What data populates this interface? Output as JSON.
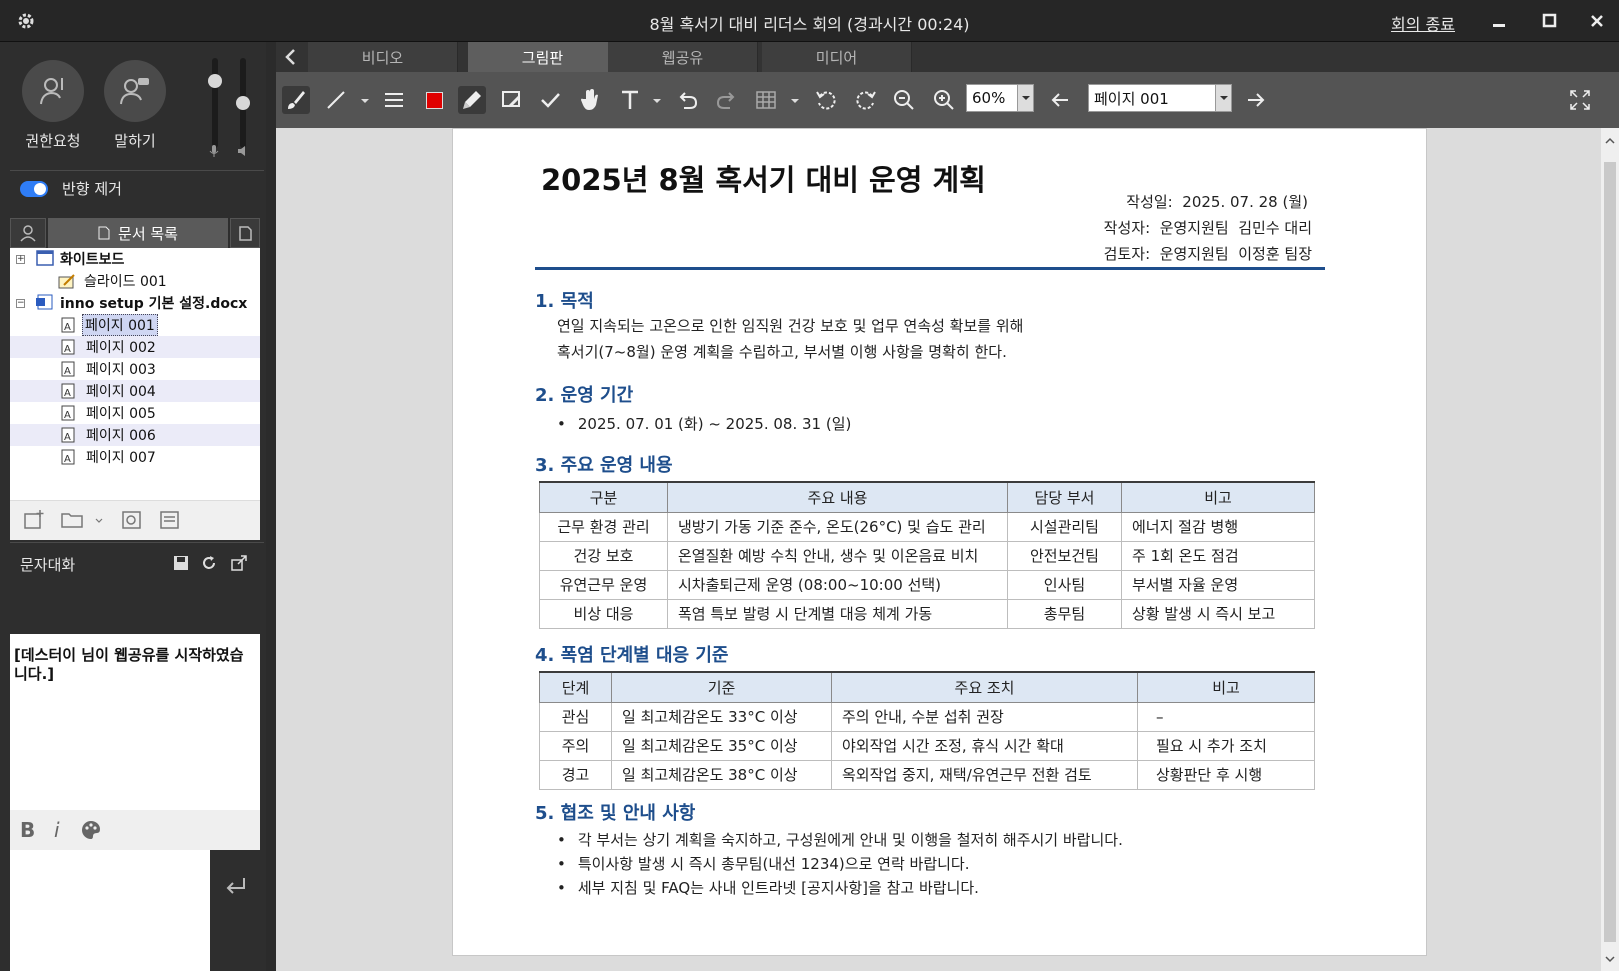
{
  "window": {
    "title": "8월 혹서기 대비 리더스 회의 (경과시간 00:24)",
    "end_meeting": "회의 종료"
  },
  "left": {
    "request_label": "권한요청",
    "speak_label": "말하기",
    "echo_label": "반향 제거",
    "echo_on": true,
    "doc_tab_label": "문서 목록",
    "tree": [
      {
        "label": "화이트보드",
        "level": 0,
        "type": "whiteboard"
      },
      {
        "label": "슬라이드 001",
        "level": 1,
        "type": "slide"
      },
      {
        "label": "inno setup 기본 설정.docx",
        "level": 0,
        "type": "docx"
      },
      {
        "label": "페이지 001",
        "level": 1,
        "type": "page",
        "selected": true
      },
      {
        "label": "페이지 002",
        "level": 1,
        "type": "page"
      },
      {
        "label": "페이지 003",
        "level": 1,
        "type": "page"
      },
      {
        "label": "페이지 004",
        "level": 1,
        "type": "page"
      },
      {
        "label": "페이지 005",
        "level": 1,
        "type": "page"
      },
      {
        "label": "페이지 006",
        "level": 1,
        "type": "page"
      },
      {
        "label": "페이지 007",
        "level": 1,
        "type": "page"
      }
    ],
    "chat_title": "문자대화",
    "chat_message": "[데스터이 님이 웹공유를 시작하였습니다.]",
    "chat_bold": "B",
    "chat_italic": "i"
  },
  "tabs": [
    "비디오",
    "그림판",
    "웹공유",
    "미디어"
  ],
  "active_tab": 1,
  "toolbar": {
    "zoom": "60%",
    "page": "페이지 001",
    "pen_color": "#e00000"
  },
  "document": {
    "title": "2025년 8월 혹서기 대비 운영 계획",
    "meta": [
      {
        "key": "작성일:",
        "value": "2025. 07. 28 (월)"
      },
      {
        "key": "작성자:",
        "value": "운영지원팀  김민수 대리"
      },
      {
        "key": "검토자:",
        "value": "운영지원팀  이정훈 팀장"
      }
    ],
    "sec1_title": "1. 목적",
    "sec1_lines": [
      "연일 지속되는 고온으로 인한 임직원 건강 보호 및 업무 연속성 확보를 위해",
      "혹서기(7~8월) 운영 계획을 수립하고, 부서별 이행 사항을 명확히 한다."
    ],
    "sec2_title": "2. 운영 기간",
    "sec2_bullets": [
      "2025. 07. 01 (화) ~ 2025. 08. 31 (일)"
    ],
    "sec3_title": "3. 주요 운영 내용",
    "table1": {
      "headers": [
        "구분",
        "주요 내용",
        "담당 부서",
        "비고"
      ],
      "rows": [
        [
          "근무 환경 관리",
          "냉방기 가동 기준 준수, 온도(26°C) 및 습도 관리",
          "시설관리팀",
          "에너지 절감 병행"
        ],
        [
          "건강 보호",
          "온열질환 예방 수칙 안내, 생수 및 이온음료 비치",
          "안전보건팀",
          "주 1회 온도 점검"
        ],
        [
          "유연근무 운영",
          "시차출퇴근제 운영 (08:00~10:00 선택)",
          "인사팀",
          "부서별 자율 운영"
        ],
        [
          "비상 대응",
          "폭염 특보 발령 시 단계별 대응 체계 가동",
          "총무팀",
          "상황 발생 시 즉시 보고"
        ]
      ]
    },
    "sec4_title": "4. 폭염 단계별 대응 기준",
    "table2": {
      "headers": [
        "단계",
        "기준",
        "주요 조치",
        "비고"
      ],
      "rows": [
        [
          "관심",
          "일 최고체감온도 33°C 이상",
          "주의 안내, 수분 섭취 권장",
          "–"
        ],
        [
          "주의",
          "일 최고체감온도 35°C 이상",
          "야외작업 시간 조정, 휴식 시간 확대",
          "필요 시 추가 조치"
        ],
        [
          "경고",
          "일 최고체감온도 38°C 이상",
          "옥외작업 중지, 재택/유연근무 전환 검토",
          "상황판단 후 시행"
        ]
      ]
    },
    "sec5_title": "5. 협조 및 안내 사항",
    "sec5_bullets": [
      "각 부서는 상기 계획을 숙지하고, 구성원에게 안내 및 이행을 철저히 해주시기 바랍니다.",
      "특이사항 발생 시 즉시 총무팀(내선 1234)으로 연락 바랍니다.",
      "세부 지침 및 FAQ는 사내 인트라넷 [공지사항]을 참고 바랍니다."
    ]
  }
}
